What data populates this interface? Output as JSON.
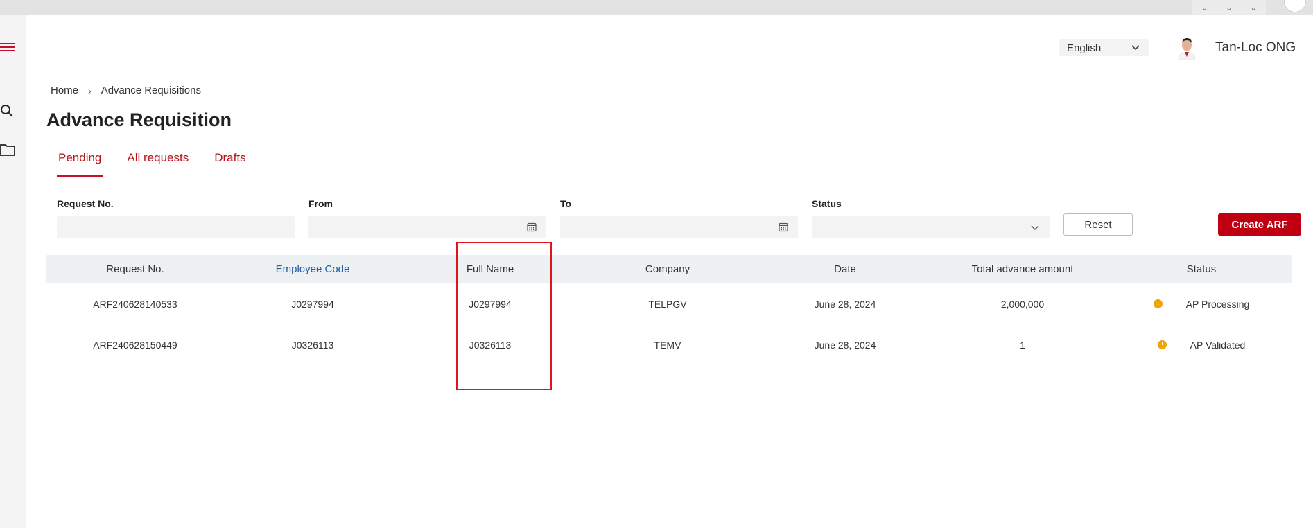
{
  "header": {
    "language": "English",
    "username": "Tan-Loc ONG"
  },
  "breadcrumb": {
    "home": "Home",
    "separator": "›",
    "current": "Advance Requisitions"
  },
  "page": {
    "title": "Advance Requisition"
  },
  "tabs": [
    {
      "label": "Pending",
      "active": true
    },
    {
      "label": "All requests",
      "active": false
    },
    {
      "label": "Drafts",
      "active": false
    }
  ],
  "filters": {
    "request_no": {
      "label": "Request No.",
      "value": ""
    },
    "from": {
      "label": "From",
      "value": ""
    },
    "to": {
      "label": "To",
      "value": ""
    },
    "status": {
      "label": "Status",
      "value": ""
    }
  },
  "buttons": {
    "reset": "Reset",
    "create": "Create ARF"
  },
  "table": {
    "columns": [
      "Request No.",
      "Employee Code",
      "Full Name",
      "Company",
      "Date",
      "Total advance amount",
      "Status"
    ],
    "rows": [
      {
        "request_no": "ARF240628140533",
        "employee_code": "J0297994",
        "full_name": "J0297994",
        "company": "TELPGV",
        "date": "June 28, 2024",
        "amount": "2,000,000",
        "status": "AP Processing"
      },
      {
        "request_no": "ARF240628150449",
        "employee_code": "J0326113",
        "full_name": "J0326113",
        "company": "TEMV",
        "date": "June 28, 2024",
        "amount": "1",
        "status": "AP Validated"
      }
    ]
  },
  "colors": {
    "brand": "#c00012",
    "status_pending": "#f0a500",
    "link": "#1f5ba8",
    "highlight": "#e0141e"
  },
  "icons": [
    "menu-icon",
    "search-icon",
    "folder-icon",
    "chevron-down-icon",
    "calendar-icon",
    "clock-icon"
  ]
}
